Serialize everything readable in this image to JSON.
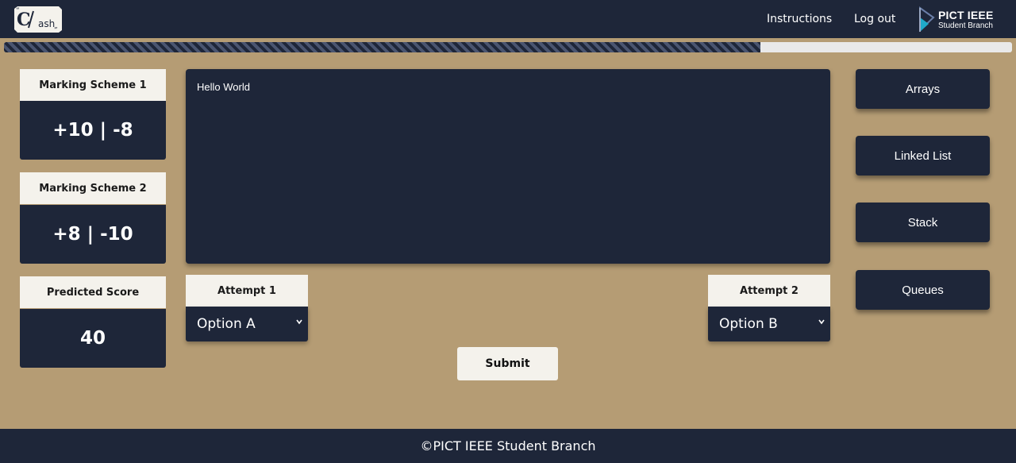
{
  "header": {
    "logo_text": "C/ash",
    "nav": {
      "instructions": "Instructions",
      "logout": "Log out"
    },
    "org": {
      "title": "PICT IEEE",
      "subtitle": "Student Branch"
    }
  },
  "progress": {
    "fraction": 0.75
  },
  "scores": [
    {
      "label": "Marking Scheme 1",
      "value": "+10 | -8"
    },
    {
      "label": "Marking Scheme 2",
      "value": "+8 | -10"
    },
    {
      "label": "Predicted Score",
      "value": "40"
    }
  ],
  "question": {
    "text": "Hello World"
  },
  "attempts": [
    {
      "label": "Attempt 1",
      "selected": "Option A"
    },
    {
      "label": "Attempt 2",
      "selected": "Option B"
    }
  ],
  "submit_label": "Submit",
  "topics": [
    "Arrays",
    "Linked List",
    "Stack",
    "Queues"
  ],
  "footer": {
    "text": "©PICT IEEE Student Branch"
  },
  "colors": {
    "navy": "#1e2639",
    "background": "#b59c74",
    "card": "#f4f2ec"
  }
}
